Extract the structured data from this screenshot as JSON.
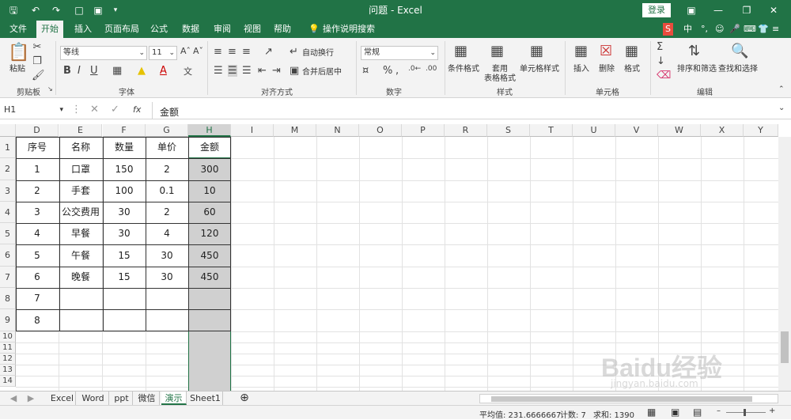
{
  "title_bar": {
    "title": "问题  -  Excel",
    "login": "登录",
    "qat": [
      "save-icon",
      "undo-icon",
      "redo-icon",
      "new-file-icon",
      "print-preview-icon",
      "customize-icon"
    ]
  },
  "tabs": [
    "文件",
    "开始",
    "插入",
    "页面布局",
    "公式",
    "数据",
    "审阅",
    "视图",
    "帮助",
    "操作说明搜索"
  ],
  "active_tab": "开始",
  "ribbon": {
    "clipboard": {
      "paste": "粘贴",
      "label": "剪贴板"
    },
    "font": {
      "name": "等线",
      "size": "11",
      "bold": "B",
      "italic": "I",
      "underline": "U",
      "label": "字体"
    },
    "alignment": {
      "wrap": "自动换行",
      "merge": "合并后居中",
      "label": "对齐方式"
    },
    "number": {
      "format": "常规",
      "label": "数字"
    },
    "styles": {
      "conditional": "条件格式",
      "table": "套用\n表格格式",
      "cell_styles": "单元格样式",
      "label": "样式"
    },
    "cells": {
      "insert": "插入",
      "delete": "删除",
      "format": "格式",
      "label": "单元格"
    },
    "editing": {
      "sort": "排序和筛选",
      "find": "查找和选择",
      "label": "编辑"
    }
  },
  "formula_bar": {
    "name_box": "H1",
    "fx": "fx",
    "value": "金额"
  },
  "columns": [
    "D",
    "E",
    "F",
    "G",
    "H",
    "I",
    "M",
    "N",
    "O",
    "P",
    "R",
    "S",
    "T",
    "U",
    "V",
    "W",
    "X",
    "Y"
  ],
  "selected_column": "H",
  "rows": [
    "1",
    "2",
    "3",
    "4",
    "5",
    "6",
    "7",
    "8",
    "9",
    "10",
    "11",
    "12",
    "13",
    "14"
  ],
  "table": {
    "headers": [
      "序号",
      "名称",
      "数量",
      "单价",
      "金额"
    ],
    "data": [
      [
        "1",
        "口罩",
        "150",
        "2",
        "300"
      ],
      [
        "2",
        "手套",
        "100",
        "0.1",
        "10"
      ],
      [
        "3",
        "公交费用",
        "30",
        "2",
        "60"
      ],
      [
        "4",
        "早餐",
        "30",
        "4",
        "120"
      ],
      [
        "5",
        "午餐",
        "15",
        "30",
        "450"
      ],
      [
        "6",
        "晚餐",
        "15",
        "30",
        "450"
      ],
      [
        "7",
        "",
        "",
        "",
        ""
      ],
      [
        "8",
        "",
        "",
        "",
        ""
      ]
    ]
  },
  "sheet_tabs": [
    "Excel",
    "Word",
    "ppt",
    "微信",
    "演示",
    "Sheet1"
  ],
  "active_sheet": "演示",
  "status": {
    "average": "平均值: 231.6666667",
    "count": "计数: 7",
    "sum": "求和: 1390"
  },
  "watermark": {
    "brand": "Baidu经验",
    "url": "jingyan.baidu.com"
  },
  "colors": {
    "excel_green": "#217346",
    "selected_fill": "#d0d0d0",
    "ribbon_bg": "#f3f3f3"
  }
}
